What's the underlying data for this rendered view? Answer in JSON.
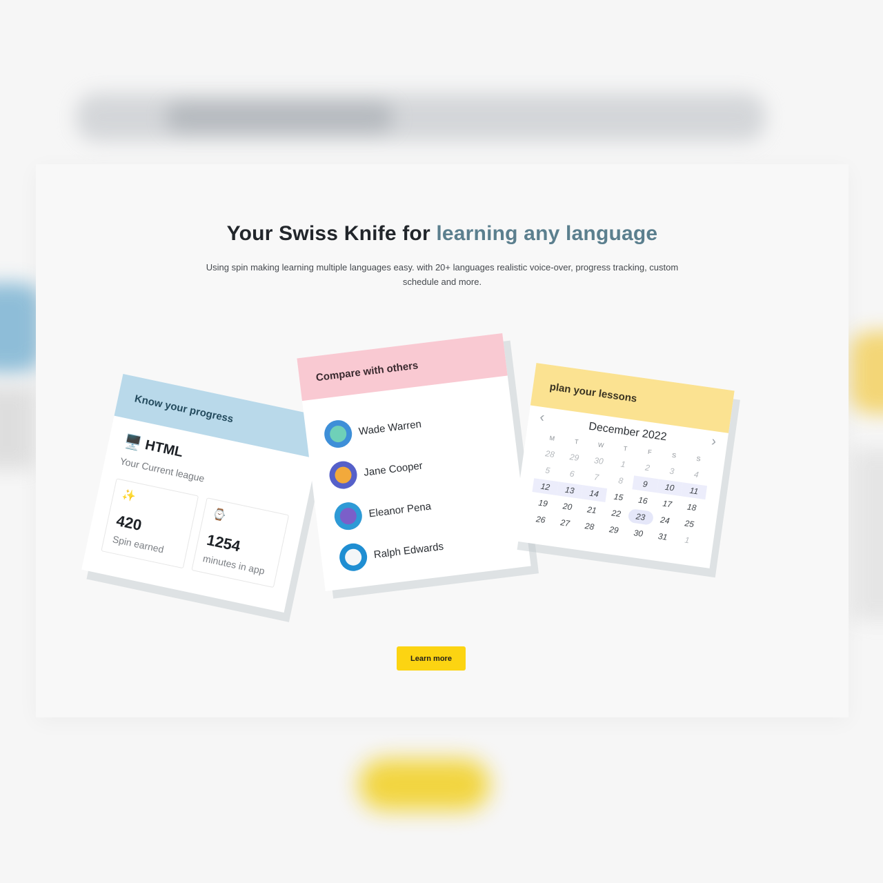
{
  "hero": {
    "title_part1": "Your Swiss Knife for ",
    "title_accent": "learning any language",
    "subtitle": "Using spin making learning multiple languages easy. with 20+ languages realistic voice-over, progress tracking, custom schedule and more."
  },
  "progress_card": {
    "header": "Know your progress",
    "league_icon": "monitor-icon",
    "league": "HTML",
    "league_caption": "Your Current league",
    "stats": [
      {
        "icon": "sparkles-icon",
        "value": "420",
        "label": "Spin earned"
      },
      {
        "icon": "watch-icon",
        "value": "1254",
        "label": "minutes in app"
      }
    ]
  },
  "compare_card": {
    "header": "Compare with others",
    "people": [
      {
        "name": "Wade Warren"
      },
      {
        "name": "Jane Cooper"
      },
      {
        "name": "Eleanor Pena"
      },
      {
        "name": "Ralph Edwards"
      }
    ]
  },
  "schedule_card": {
    "header": "plan your lessons",
    "month": "December 2022",
    "weekdays": [
      "M",
      "T",
      "W",
      "T",
      "F",
      "S",
      "S"
    ],
    "weeks": [
      [
        "28",
        "29",
        "30",
        "1",
        "2",
        "3",
        "4"
      ],
      [
        "5",
        "6",
        "7",
        "8",
        "9",
        "10",
        "11"
      ],
      [
        "12",
        "13",
        "14",
        "15",
        "16",
        "17",
        "18"
      ],
      [
        "19",
        "20",
        "21",
        "22",
        "23",
        "24",
        "25"
      ],
      [
        "26",
        "27",
        "28",
        "29",
        "30",
        "31",
        "1"
      ]
    ]
  },
  "cta": {
    "label": "Learn more"
  },
  "colors": {
    "accent_text": "#5b7f8e",
    "progress_header": "#b9d9ea",
    "compare_header": "#f9c9d2",
    "schedule_header": "#fbe291",
    "cta": "#fcd412"
  }
}
